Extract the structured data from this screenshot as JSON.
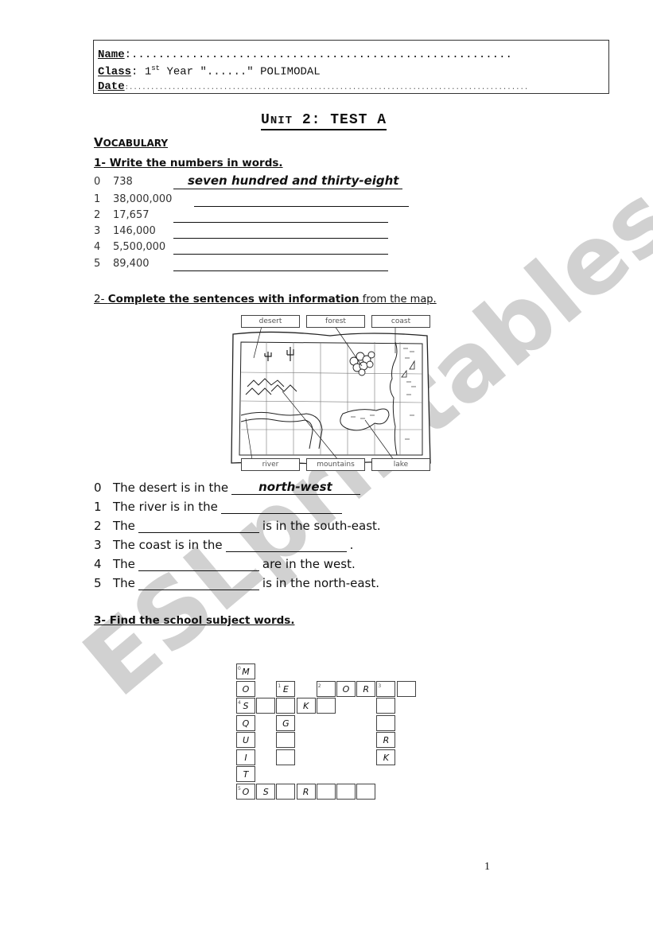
{
  "header": {
    "name_label": "Name",
    "name_value": ":.........................................................",
    "class_label": "Class",
    "class_pre": ": 1",
    "class_sup": "st",
    "class_post": " Year \"......\" POLIMODAL",
    "date_label": "Date",
    "date_value": ":............................................................................................."
  },
  "title": {
    "first_letter": "U",
    "rest_sc": "NIT",
    "after": " 2: TEST A"
  },
  "vocabulary": {
    "first_letter": "V",
    "rest": "OCABULARY"
  },
  "exercise1": {
    "heading": "1- Write the numbers in words.",
    "rows": [
      {
        "index": "0",
        "number": "738",
        "answer": "seven hundred and thirty-eight"
      },
      {
        "index": "1",
        "number": "38,000,000",
        "answer": ""
      },
      {
        "index": "2",
        "number": "17,657",
        "answer": ""
      },
      {
        "index": "3",
        "number": "146,000",
        "answer": ""
      },
      {
        "index": "4",
        "number": "5,500,000",
        "answer": ""
      },
      {
        "index": "5",
        "number": "89,400",
        "answer": ""
      }
    ]
  },
  "exercise2": {
    "heading_num": "2- ",
    "heading_bold": "Complete the sentences with information",
    "heading_normal": " from the map.",
    "map_labels": {
      "desert": "desert",
      "forest": "forest",
      "coast": "coast",
      "river": "river",
      "mountains": "mountains",
      "lake": "lake"
    },
    "sentences": [
      {
        "index": "0",
        "before": "The desert is in the",
        "answer": "north-west",
        "after": ""
      },
      {
        "index": "1",
        "before": "The river is in the",
        "answer": "",
        "after": ""
      },
      {
        "index": "2",
        "before": "The",
        "answer": "",
        "after": "is in the south-east."
      },
      {
        "index": "3",
        "before": "The coast is in the",
        "answer": "",
        "after": "."
      },
      {
        "index": "4",
        "before": "The",
        "answer": "",
        "after": "are in the west."
      },
      {
        "index": "5",
        "before": "The",
        "answer": "",
        "after": "is in the north-east."
      }
    ]
  },
  "exercise3": {
    "heading": "3- Find the school subject words.",
    "crossword": {
      "cells": [
        {
          "col": 0,
          "row": 0,
          "letter": "M",
          "clue": "0"
        },
        {
          "col": 0,
          "row": 1,
          "letter": "O",
          "clue": ""
        },
        {
          "col": 0,
          "row": 2,
          "letter": "S",
          "clue": "4"
        },
        {
          "col": 0,
          "row": 3,
          "letter": "Q",
          "clue": ""
        },
        {
          "col": 0,
          "row": 4,
          "letter": "U",
          "clue": ""
        },
        {
          "col": 0,
          "row": 5,
          "letter": "I",
          "clue": ""
        },
        {
          "col": 0,
          "row": 6,
          "letter": "T",
          "clue": ""
        },
        {
          "col": 0,
          "row": 7,
          "letter": "O",
          "clue": "5"
        },
        {
          "col": 2,
          "row": 1,
          "letter": "E",
          "clue": "1"
        },
        {
          "col": 2,
          "row": 2,
          "letter": "",
          "clue": ""
        },
        {
          "col": 2,
          "row": 3,
          "letter": "G",
          "clue": ""
        },
        {
          "col": 2,
          "row": 4,
          "letter": "",
          "clue": ""
        },
        {
          "col": 2,
          "row": 5,
          "letter": "",
          "clue": ""
        },
        {
          "col": 1,
          "row": 2,
          "letter": "",
          "clue": ""
        },
        {
          "col": 3,
          "row": 2,
          "letter": "K",
          "clue": ""
        },
        {
          "col": 4,
          "row": 2,
          "letter": "",
          "clue": ""
        },
        {
          "col": 4,
          "row": 1,
          "letter": "",
          "clue": "2"
        },
        {
          "col": 5,
          "row": 1,
          "letter": "O",
          "clue": ""
        },
        {
          "col": 6,
          "row": 1,
          "letter": "R",
          "clue": ""
        },
        {
          "col": 7,
          "row": 1,
          "letter": "",
          "clue": "3"
        },
        {
          "col": 8,
          "row": 1,
          "letter": "",
          "clue": ""
        },
        {
          "col": 7,
          "row": 2,
          "letter": "",
          "clue": ""
        },
        {
          "col": 7,
          "row": 3,
          "letter": "",
          "clue": ""
        },
        {
          "col": 7,
          "row": 4,
          "letter": "R",
          "clue": ""
        },
        {
          "col": 7,
          "row": 5,
          "letter": "K",
          "clue": ""
        },
        {
          "col": 1,
          "row": 7,
          "letter": "S",
          "clue": ""
        },
        {
          "col": 2,
          "row": 7,
          "letter": "",
          "clue": ""
        },
        {
          "col": 3,
          "row": 7,
          "letter": "R",
          "clue": ""
        },
        {
          "col": 4,
          "row": 7,
          "letter": "",
          "clue": ""
        },
        {
          "col": 5,
          "row": 7,
          "letter": "",
          "clue": ""
        },
        {
          "col": 6,
          "row": 7,
          "letter": "",
          "clue": ""
        }
      ]
    }
  },
  "page_number": "1",
  "watermark": "ESLprintables.com",
  "colors": {
    "watermark": "#c8c8c8",
    "text": "#111111"
  }
}
